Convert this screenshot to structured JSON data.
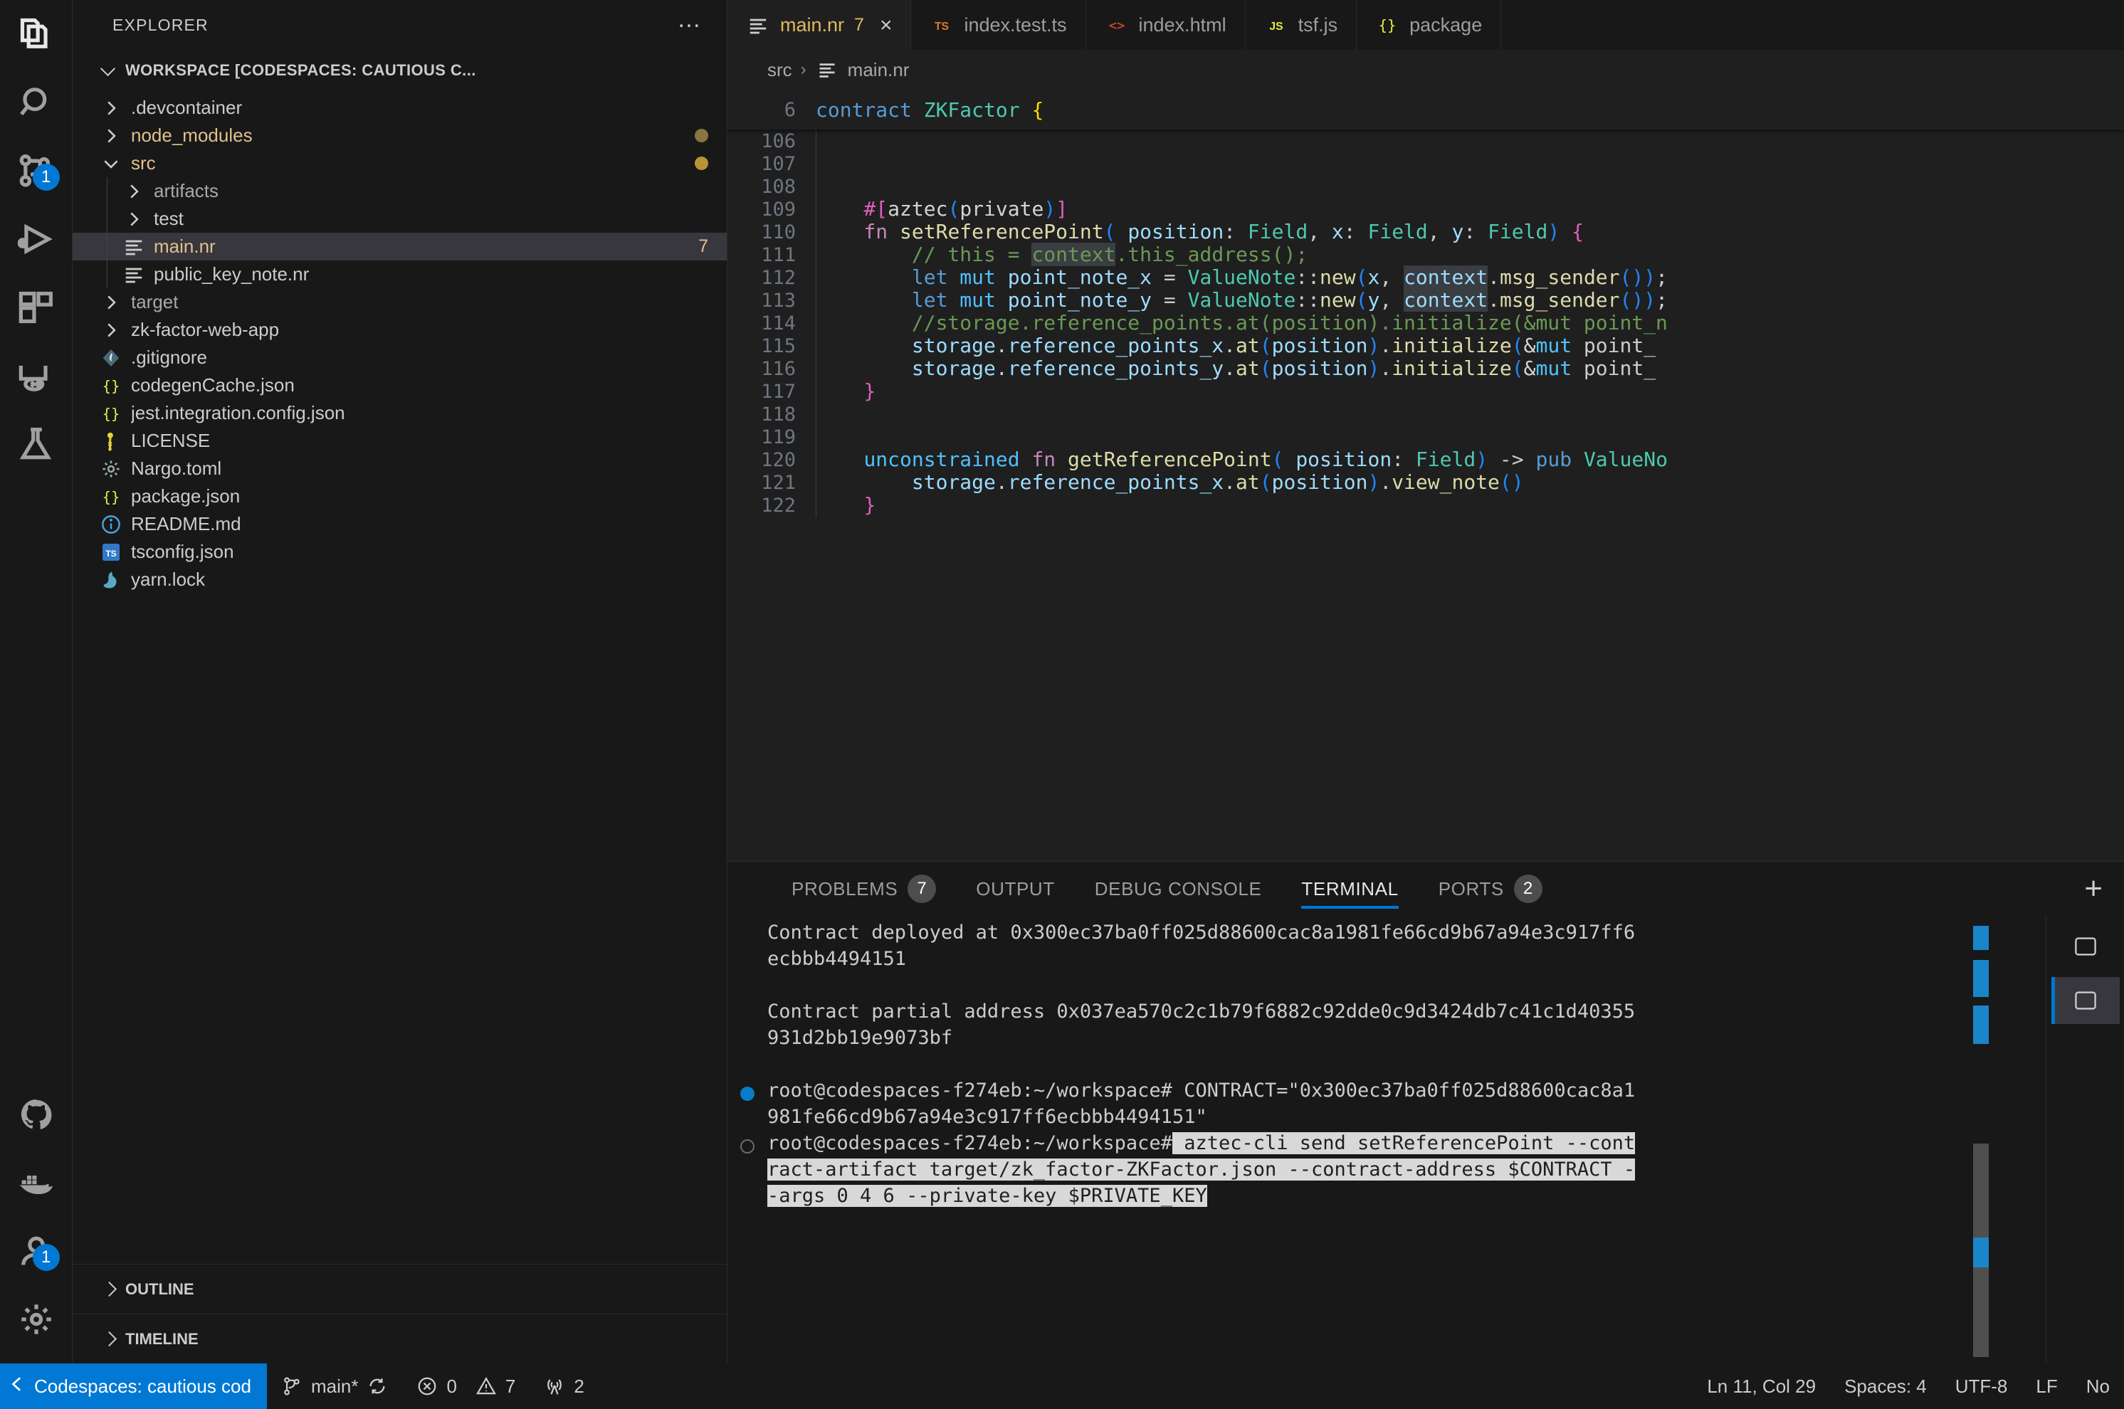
{
  "activitybar": {
    "items": [
      {
        "name": "explorer",
        "icon": "files-icon",
        "badge": null,
        "active": true
      },
      {
        "name": "search",
        "icon": "search-icon",
        "badge": null,
        "active": false
      },
      {
        "name": "source-control",
        "icon": "source-control-icon",
        "badge": "1",
        "active": false
      },
      {
        "name": "run-and-debug",
        "icon": "run-debug-icon",
        "badge": null,
        "active": false
      },
      {
        "name": "extensions",
        "icon": "extensions-icon",
        "badge": null,
        "active": false
      },
      {
        "name": "remote-explorer",
        "icon": "remote-explorer-icon",
        "badge": null,
        "active": false
      },
      {
        "name": "testing",
        "icon": "beaker-icon",
        "badge": null,
        "active": false
      },
      {
        "name": "github",
        "icon": "github-icon",
        "badge": null,
        "active": false
      },
      {
        "name": "docker",
        "icon": "docker-icon",
        "badge": null,
        "active": false
      },
      {
        "name": "accounts",
        "icon": "accounts-icon",
        "badge": "1",
        "active": false
      },
      {
        "name": "settings",
        "icon": "gear-icon",
        "badge": null,
        "active": false
      }
    ]
  },
  "sidebar": {
    "title": "EXPLORER",
    "more_actions": "…",
    "workspace_label": "WORKSPACE [CODESPACES: CAUTIOUS C...",
    "tree": [
      {
        "label": ".devcontainer",
        "type": "folder",
        "depth": 0,
        "expanded": false,
        "icon": "chevron-right-icon",
        "badge": null,
        "dot": null,
        "style": "normal"
      },
      {
        "label": "node_modules",
        "type": "folder",
        "depth": 0,
        "expanded": false,
        "icon": "chevron-right-icon",
        "badge": null,
        "dot": "dim",
        "style": "mod"
      },
      {
        "label": "src",
        "type": "folder",
        "depth": 0,
        "expanded": true,
        "icon": "chevron-down-icon",
        "badge": null,
        "dot": "bright",
        "style": "mod"
      },
      {
        "label": "artifacts",
        "type": "folder",
        "depth": 1,
        "expanded": false,
        "icon": "chevron-right-icon",
        "badge": null,
        "dot": null,
        "style": "dim"
      },
      {
        "label": "test",
        "type": "folder",
        "depth": 1,
        "expanded": false,
        "icon": "chevron-right-icon",
        "badge": null,
        "dot": null,
        "style": "normal"
      },
      {
        "label": "main.nr",
        "type": "file",
        "depth": 1,
        "expanded": false,
        "icon": "noir-icon",
        "badge": "7",
        "dot": null,
        "style": "mod",
        "selected": true
      },
      {
        "label": "public_key_note.nr",
        "type": "file",
        "depth": 1,
        "expanded": false,
        "icon": "noir-icon",
        "badge": null,
        "dot": null,
        "style": "normal"
      },
      {
        "label": "target",
        "type": "folder",
        "depth": 0,
        "expanded": false,
        "icon": "chevron-right-icon",
        "badge": null,
        "dot": null,
        "style": "dim"
      },
      {
        "label": "zk-factor-web-app",
        "type": "folder",
        "depth": 0,
        "expanded": false,
        "icon": "chevron-right-icon",
        "badge": null,
        "dot": null,
        "style": "normal"
      },
      {
        "label": ".gitignore",
        "type": "file",
        "depth": 0,
        "expanded": false,
        "icon": "git-icon",
        "badge": null,
        "dot": null,
        "style": "normal"
      },
      {
        "label": "codegenCache.json",
        "type": "file",
        "depth": 0,
        "expanded": false,
        "icon": "json-icon",
        "badge": null,
        "dot": null,
        "style": "normal"
      },
      {
        "label": "jest.integration.config.json",
        "type": "file",
        "depth": 0,
        "expanded": false,
        "icon": "json-icon",
        "badge": null,
        "dot": null,
        "style": "normal"
      },
      {
        "label": "LICENSE",
        "type": "file",
        "depth": 0,
        "expanded": false,
        "icon": "key-icon",
        "badge": null,
        "dot": null,
        "style": "normal"
      },
      {
        "label": "Nargo.toml",
        "type": "file",
        "depth": 0,
        "expanded": false,
        "icon": "gear-file-icon",
        "badge": null,
        "dot": null,
        "style": "normal"
      },
      {
        "label": "package.json",
        "type": "file",
        "depth": 0,
        "expanded": false,
        "icon": "json-icon",
        "badge": null,
        "dot": null,
        "style": "normal"
      },
      {
        "label": "README.md",
        "type": "file",
        "depth": 0,
        "expanded": false,
        "icon": "info-icon",
        "badge": null,
        "dot": null,
        "style": "normal"
      },
      {
        "label": "tsconfig.json",
        "type": "file",
        "depth": 0,
        "expanded": false,
        "icon": "ts-icon",
        "badge": null,
        "dot": null,
        "style": "normal"
      },
      {
        "label": "yarn.lock",
        "type": "file",
        "depth": 0,
        "expanded": false,
        "icon": "yarn-icon",
        "badge": null,
        "dot": null,
        "style": "normal"
      }
    ],
    "bottom_sections": [
      {
        "label": "OUTLINE",
        "expanded": false
      },
      {
        "label": "TIMELINE",
        "expanded": false
      }
    ]
  },
  "editor": {
    "tabs": [
      {
        "label": "main.nr",
        "icon": "noir-icon",
        "count": "7",
        "close": "×",
        "active": true
      },
      {
        "label": "index.test.ts",
        "icon": "ts-icon",
        "count": null,
        "close": null,
        "active": false
      },
      {
        "label": "index.html",
        "icon": "html-icon",
        "count": null,
        "close": null,
        "active": false
      },
      {
        "label": "tsf.js",
        "icon": "js-icon",
        "count": null,
        "close": null,
        "active": false
      },
      {
        "label": "package",
        "icon": "json-icon",
        "count": null,
        "close": null,
        "active": false
      }
    ],
    "breadcrumb": [
      "src",
      "main.nr"
    ],
    "sticky_line": {
      "number": "6",
      "text": "contract ZKFactor {"
    },
    "lines": [
      {
        "number": "106",
        "text": ""
      },
      {
        "number": "107",
        "text": ""
      },
      {
        "number": "108",
        "text": ""
      },
      {
        "number": "109",
        "text": "    #[aztec(private)]"
      },
      {
        "number": "110",
        "text": "    fn setReferencePoint( position: Field, x: Field, y: Field) {"
      },
      {
        "number": "111",
        "text": "        // this = context.this_address();"
      },
      {
        "number": "112",
        "text": "        let mut point_note_x = ValueNote::new(x, context.msg_sender());"
      },
      {
        "number": "113",
        "text": "        let mut point_note_y = ValueNote::new(y, context.msg_sender());"
      },
      {
        "number": "114",
        "text": "        //storage.reference_points.at(position).initialize(&mut point_n"
      },
      {
        "number": "115",
        "text": "        storage.reference_points_x.at(position).initialize(&mut point_"
      },
      {
        "number": "116",
        "text": "        storage.reference_points_y.at(position).initialize(&mut point_"
      },
      {
        "number": "117",
        "text": "    }"
      },
      {
        "number": "118",
        "text": ""
      },
      {
        "number": "119",
        "text": ""
      },
      {
        "number": "120",
        "text": "    unconstrained fn getReferencePoint( position: Field) -> pub ValueNo"
      },
      {
        "number": "121",
        "text": "        storage.reference_points_x.at(position).view_note()"
      },
      {
        "number": "122",
        "text": "    }"
      }
    ]
  },
  "panel": {
    "tabs": [
      {
        "label": "PROBLEMS",
        "badge": "7",
        "active": false
      },
      {
        "label": "OUTPUT",
        "badge": null,
        "active": false
      },
      {
        "label": "DEBUG CONSOLE",
        "badge": null,
        "active": false
      },
      {
        "label": "TERMINAL",
        "badge": null,
        "active": true
      },
      {
        "label": "PORTS",
        "badge": "2",
        "active": false
      }
    ],
    "new_terminal_label": "+",
    "terminal_lines": [
      {
        "text": "Contract deployed at 0x300ec37ba0ff025d88600cac8a1981fe66cd9b67a94e3c917ff6",
        "bullet": null,
        "selected": false
      },
      {
        "text": "ecbbb4494151",
        "bullet": null,
        "selected": false
      },
      {
        "text": "",
        "bullet": null,
        "selected": false
      },
      {
        "text": "Contract partial address 0x037ea570c2c1b79f6882c92dde0c9d3424db7c41c1d40355",
        "bullet": null,
        "selected": false
      },
      {
        "text": "931d2bb19e9073bf",
        "bullet": null,
        "selected": false
      },
      {
        "text": "",
        "bullet": null,
        "selected": false
      },
      {
        "text": "root@codespaces-f274eb:~/workspace# CONTRACT=\"0x300ec37ba0ff025d88600cac8a1",
        "bullet": "done",
        "selected": false
      },
      {
        "text": "981fe66cd9b67a94e3c917ff6ecbbb4494151\"",
        "bullet": null,
        "selected": false
      },
      {
        "text": "root@codespaces-f274eb:~/workspace# aztec-cli send setReferencePoint --cont",
        "bullet": "pend",
        "selected": true,
        "prompt_len": 35
      },
      {
        "text": "ract-artifact target/zk_factor-ZKFactor.json --contract-address $CONTRACT -",
        "bullet": null,
        "selected": true
      },
      {
        "text": "-args 0 4 6 --private-key $PRIVATE_KEY",
        "bullet": null,
        "selected": true
      }
    ],
    "terminal_sidebar": [
      {
        "name": "terminal-instance-1",
        "active": false
      },
      {
        "name": "terminal-instance-2",
        "active": true
      }
    ]
  },
  "statusbar": {
    "remote_label": "Codespaces: cautious cod",
    "remote_icon": "remote-icon",
    "branch": "main*",
    "sync_icon": "sync-icon",
    "errors": "0",
    "warnings": "7",
    "ports": "2",
    "cursor_position": "Ln 11, Col 29",
    "indentation": "Spaces: 4",
    "encoding": "UTF-8",
    "eol": "LF",
    "language": "No"
  },
  "colors": {
    "accent": "#0078d4",
    "editor_bg": "#1f1f1f",
    "sidebar_bg": "#181818",
    "selection": "#37373d",
    "modified": "#e2c08d"
  }
}
